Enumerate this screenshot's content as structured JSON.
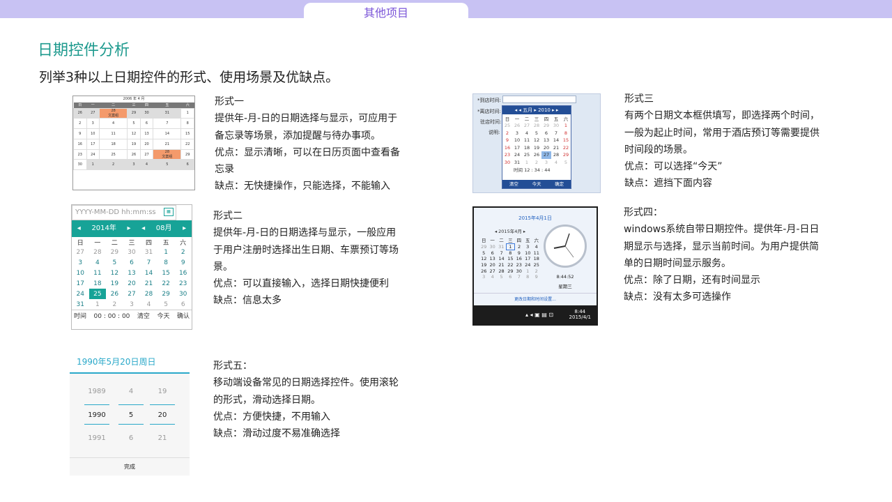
{
  "header": {
    "tab": "其他项目"
  },
  "title": "日期控件分析",
  "subtitle": "列举3种以上日期控件的形式、使用场景及优缺点。",
  "forms": [
    {
      "lines": [
        "形式一",
        "提供年-月-日的日期选择与显示，可应用于",
        "备忘录等场景，添加提醒与待办事项。",
        "优点：显示清晰，可以在日历页面中查看备",
        "忘录",
        "缺点：无快捷操作，只能选择，不能输入"
      ]
    },
    {
      "lines": [
        "形式二",
        "提供年-月-日的日期选择与显示，一般应用",
        "于用户注册时选择出生日期、车票预订等场",
        "景。",
        "优点：可以直接输入，选择日期快捷便利",
        "缺点：信息太多"
      ]
    },
    {
      "lines": [
        "形式三",
        "有两个日期文本框供填写，即选择两个时间，",
        "一般为起止时间，常用于酒店预订等需要提供",
        "时间段的场景。",
        "优点：可以选择“今天”",
        "缺点：遮挡下面内容"
      ]
    },
    {
      "lines": [
        "形式四：",
        "windows系统自带日期控件。提供年-月-日日",
        "期显示与选择，显示当前时间。为用户提供简",
        "单的日期时间显示服务。",
        "优点：除了日期，还有时间显示",
        "缺点：没有太多可选操作"
      ]
    },
    {
      "lines": [
        "形式五：",
        "移动端设备常见的日期选择控件。使用滚轮",
        "的形式，滑动选择日期。",
        "优点：方便快捷，不用输入",
        "缺点：滑动过度不易准确选择"
      ]
    }
  ],
  "f1": {
    "year": "2006",
    "month": "4",
    "suffix": "年",
    "msuffix": "月",
    "weekdays": [
      "日",
      "一",
      "二",
      "三",
      "四",
      "五",
      "六"
    ],
    "event": "文案组",
    "rows": [
      [
        "26",
        "27",
        "28",
        "29",
        "30",
        "31",
        "1"
      ],
      [
        "2",
        "3",
        "4",
        "5",
        "6",
        "7",
        "8"
      ],
      [
        "9",
        "10",
        "11",
        "12",
        "13",
        "14",
        "15"
      ],
      [
        "16",
        "17",
        "18",
        "19",
        "20",
        "21",
        "22"
      ],
      [
        "23",
        "24",
        "25",
        "26",
        "27",
        "28",
        "29"
      ],
      [
        "30",
        "1",
        "2",
        "3",
        "4",
        "5",
        "6"
      ]
    ]
  },
  "f2": {
    "placeholder": "YYYY-MM-DD hh:mm:ss",
    "year": "2014年",
    "month": "08月",
    "weekdays": [
      "日",
      "一",
      "二",
      "三",
      "四",
      "五",
      "六"
    ],
    "rows": [
      [
        "27",
        "28",
        "29",
        "30",
        "31",
        "1",
        "2"
      ],
      [
        "3",
        "4",
        "5",
        "6",
        "7",
        "8",
        "9"
      ],
      [
        "10",
        "11",
        "12",
        "13",
        "14",
        "15",
        "16"
      ],
      [
        "17",
        "18",
        "19",
        "20",
        "21",
        "22",
        "23"
      ],
      [
        "24",
        "25",
        "26",
        "27",
        "28",
        "29",
        "30"
      ],
      [
        "31",
        "1",
        "2",
        "3",
        "4",
        "5",
        "6"
      ]
    ],
    "time_label": "时间",
    "time": "00 : 00 : 00",
    "clear": "清空",
    "today": "今天",
    "ok": "确认"
  },
  "f3": {
    "labels": [
      "*到店时间:",
      "*离店时间:",
      "驻店时间:",
      "说明:"
    ],
    "month": "五月",
    "year": "2010",
    "weekdays": [
      "日",
      "一",
      "二",
      "三",
      "四",
      "五",
      "六"
    ],
    "rows": [
      [
        "25",
        "26",
        "27",
        "28",
        "29",
        "30",
        "1"
      ],
      [
        "2",
        "3",
        "4",
        "5",
        "6",
        "7",
        "8"
      ],
      [
        "9",
        "10",
        "11",
        "12",
        "13",
        "14",
        "15"
      ],
      [
        "16",
        "17",
        "18",
        "19",
        "20",
        "21",
        "22"
      ],
      [
        "23",
        "24",
        "25",
        "26",
        "27",
        "28",
        "29"
      ],
      [
        "30",
        "31",
        "1",
        "2",
        "3",
        "4",
        "5"
      ]
    ],
    "time_label": "时间",
    "time": "12 : 34 : 44",
    "clear": "清空",
    "today": "今天",
    "ok": "确定"
  },
  "f4": {
    "date_title": "2015年4月1日",
    "month": "2015年4月",
    "weekdays": [
      "日",
      "一",
      "二",
      "三",
      "四",
      "五",
      "六"
    ],
    "rows": [
      [
        "29",
        "30",
        "31",
        "1",
        "2",
        "3",
        "4"
      ],
      [
        "5",
        "6",
        "7",
        "8",
        "9",
        "10",
        "11"
      ],
      [
        "12",
        "13",
        "14",
        "15",
        "16",
        "17",
        "18"
      ],
      [
        "19",
        "20",
        "21",
        "22",
        "23",
        "24",
        "25"
      ],
      [
        "26",
        "27",
        "28",
        "29",
        "30",
        "1",
        "2"
      ],
      [
        "3",
        "4",
        "5",
        "6",
        "7",
        "8",
        "9"
      ]
    ],
    "time": "8:44:52",
    "weekday": "星期三",
    "link": "更改日期和时间设置...",
    "task_time": "8:44",
    "task_date": "2015/4/1"
  },
  "f5": {
    "title": "1990年5月20日周日",
    "col1": [
      "1989",
      "1990",
      "1991"
    ],
    "col2": [
      "4",
      "5",
      "6"
    ],
    "col3": [
      "19",
      "20",
      "21"
    ],
    "done": "完成"
  }
}
